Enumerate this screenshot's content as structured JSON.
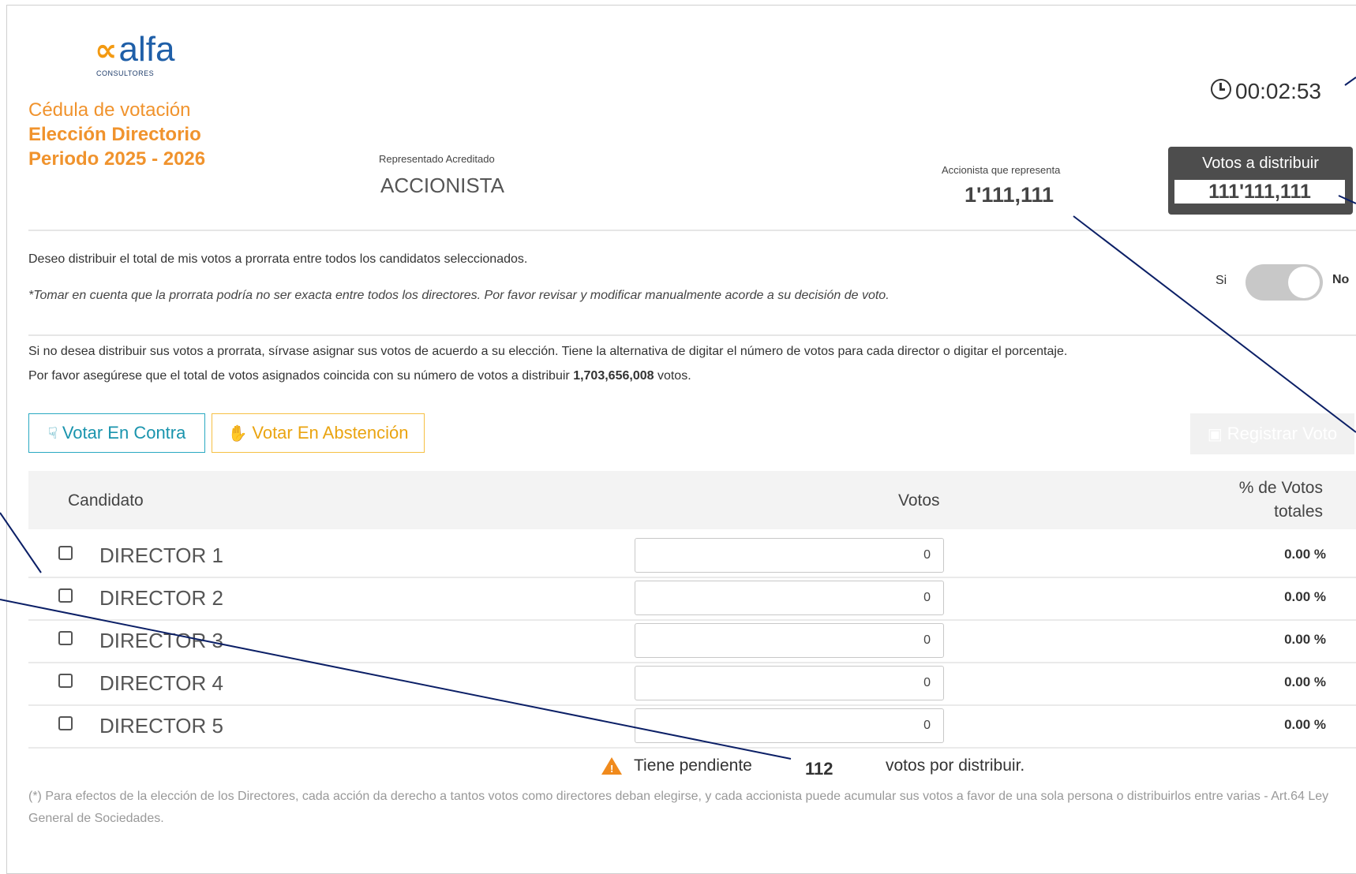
{
  "brand": {
    "logo_mark": "∝",
    "logo_word": "alfa",
    "logo_sub": "CONSULTORES"
  },
  "header": {
    "title_line1": "Cédula de votación",
    "title_line2": "Elección Directorio",
    "title_line3": "Periodo 2025 - 2026",
    "represented_label": "Representado Acreditado",
    "represented_value": "ACCIONISTA",
    "shareholder_label": "Accionista que representa",
    "shareholder_value": "1'111,111",
    "timer": "00:02:53",
    "votes_box_label": "Votos a distribuir",
    "votes_box_value": "111'111,111"
  },
  "prorrata": {
    "text": "Deseo distribuir el total de mis votos a prorrata entre todos los candidatos seleccionados.",
    "note": "*Tomar en cuenta que la prorrata podría no ser exacta entre todos los directores. Por favor revisar y modificar manualmente acorde a su decisión de voto.",
    "toggle_yes": "Si",
    "toggle_no": "No"
  },
  "instructions": {
    "line1": "Si no desea distribuir sus votos a prorrata, sírvase asignar sus votos de acuerdo a su elección. Tiene la alternativa de digitar el número de votos para cada director o digitar el porcentaje.",
    "line2_pre": "Por favor asegúrese que el total de votos asignados coincida con su número de votos a distribuir ",
    "line2_bold": "1,703,656,008",
    "line2_post": " votos."
  },
  "buttons": {
    "contra": "Votar En Contra",
    "abstencion": "Votar En Abstención",
    "registrar": "Registrar Voto"
  },
  "table": {
    "headers": {
      "candidate": "Candidato",
      "votes": "Votos",
      "pct": "% de Votos totales"
    },
    "rows": [
      {
        "name": "DIRECTOR 1",
        "votes": "0",
        "pct": "0.00 %"
      },
      {
        "name": "DIRECTOR 2",
        "votes": "0",
        "pct": "0.00 %"
      },
      {
        "name": "DIRECTOR 3",
        "votes": "0",
        "pct": "0.00 %"
      },
      {
        "name": "DIRECTOR 4",
        "votes": "0",
        "pct": "0.00 %"
      },
      {
        "name": "DIRECTOR 5",
        "votes": "0",
        "pct": "0.00 %"
      }
    ]
  },
  "pending": {
    "pre": "Tiene pendiente",
    "value": "112",
    "post": "votos por distribuir."
  },
  "footnote": "(*) Para efectos de la elección de los Directores, cada acción da derecho a tantos votos como directores deban elegirse, y cada accionista puede acumular sus votos a favor de una sola persona o distribuirlos entre varias - Art.64 Ley General de Sociedades.",
  "colors": {
    "accent_orange": "#f0932d",
    "contra_blue": "#1a94ad",
    "abst_yellow": "#eaa411",
    "annotation_line": "#0b1f66"
  }
}
